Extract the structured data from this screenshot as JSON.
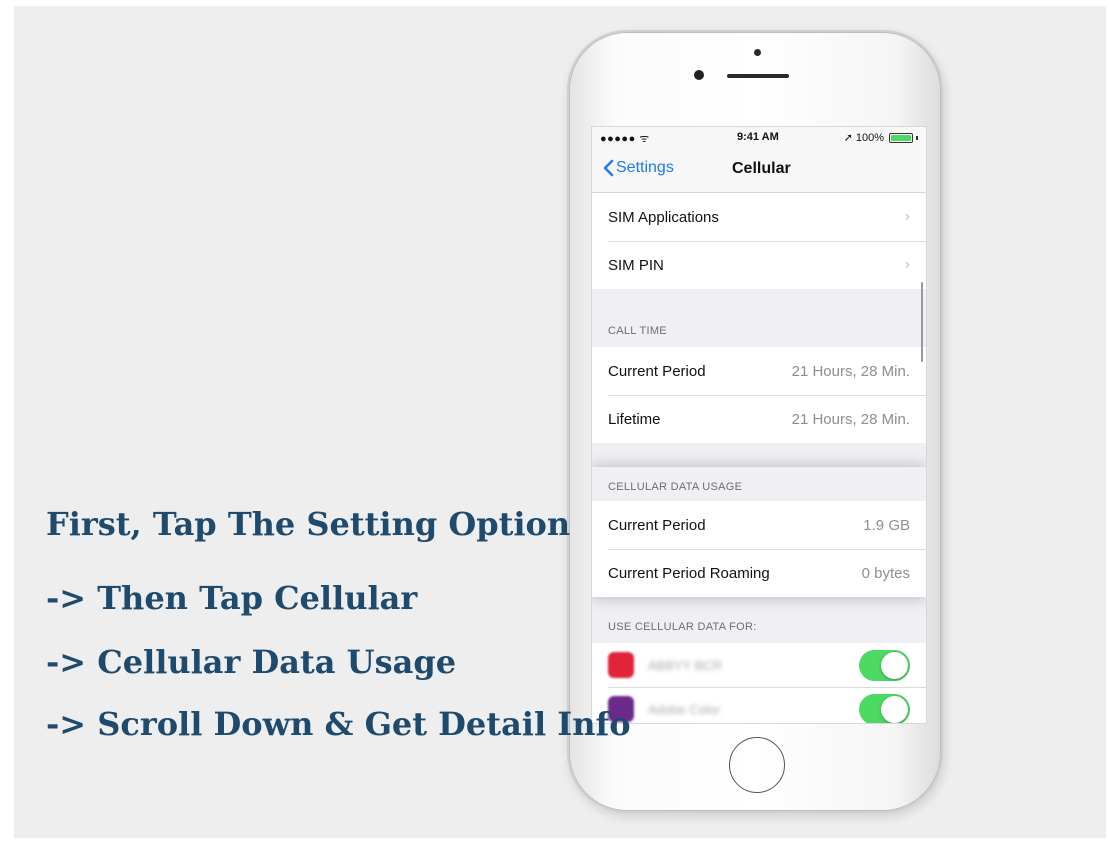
{
  "status_bar": {
    "signal": "●●●●● ᯤ",
    "time": "9:41 AM",
    "location_arrow": "➚",
    "battery_percent": "100%",
    "battery_level": 1.0
  },
  "nav": {
    "back_label": "Settings",
    "title": "Cellular"
  },
  "sim_rows": [
    {
      "label": "SIM Applications"
    },
    {
      "label": "SIM PIN"
    }
  ],
  "call_time": {
    "header": "CALL TIME",
    "rows": [
      {
        "label": "Current Period",
        "value": "21 Hours, 28 Min."
      },
      {
        "label": "Lifetime",
        "value": "21 Hours, 28 Min."
      }
    ]
  },
  "data_usage": {
    "header": "CELLULAR DATA USAGE",
    "rows": [
      {
        "label": "Current Period",
        "value": "1.9 GB"
      },
      {
        "label": "Current Period Roaming",
        "value": "0 bytes"
      }
    ]
  },
  "use_data_for": {
    "header": "USE CELLULAR DATA FOR:",
    "apps": [
      {
        "name": "ABBYY BCR",
        "icon_color": "#e0243a",
        "enabled": true
      },
      {
        "name": "Adobe Color",
        "icon_color": "#6b2a8a",
        "enabled": true
      }
    ]
  },
  "chevron": "›",
  "instructions": [
    "First, Tap The Setting Option",
    "->  Then Tap Cellular",
    "-> Cellular Data Usage",
    "-> Scroll Down & Get Detail Info"
  ],
  "colors": {
    "instruction_text": "#1e4a6e",
    "ios_blue": "#1a7bf2",
    "toggle_on": "#4cd964"
  }
}
